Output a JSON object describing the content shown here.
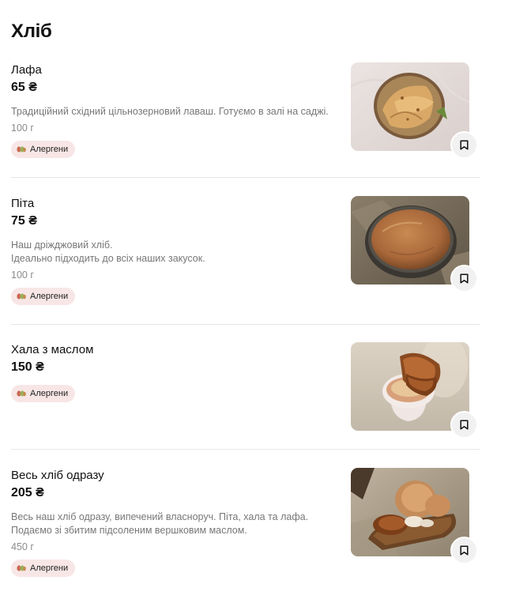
{
  "page": {
    "title": "Хліб"
  },
  "items": [
    {
      "name": "Лафа",
      "price": "65 ₴",
      "desc": [
        "Традиційний східний цільнозерновий лаваш. Готуємо в залі на саджі."
      ],
      "weight": "100 г",
      "allergen_label": "Алергени"
    },
    {
      "name": "Піта",
      "price": "75 ₴",
      "desc": [
        "Наш дріжджовий хліб.",
        "Ідеально підходить до всіх наших закусок."
      ],
      "weight": "100 г",
      "allergen_label": "Алергени"
    },
    {
      "name": "Хала з маслом",
      "price": "150 ₴",
      "desc": [],
      "weight": "",
      "allergen_label": "Алергени"
    },
    {
      "name": "Весь хліб одразу",
      "price": "205 ₴",
      "desc": [
        "Весь наш хліб одразу, випечений власноруч. Піта, хала та лафа.",
        "Подаємо зі збитим підсоленим вершковим маслом."
      ],
      "weight": "450 г",
      "allergen_label": "Алергени"
    }
  ],
  "icons": {
    "allergen": "allergen-icon",
    "bookmark": "bookmark-icon"
  },
  "colors": {
    "allergen_bg": "#f8e6e6",
    "bookmark_bg": "#f1f1f1",
    "divider": "#e6e6e6"
  }
}
